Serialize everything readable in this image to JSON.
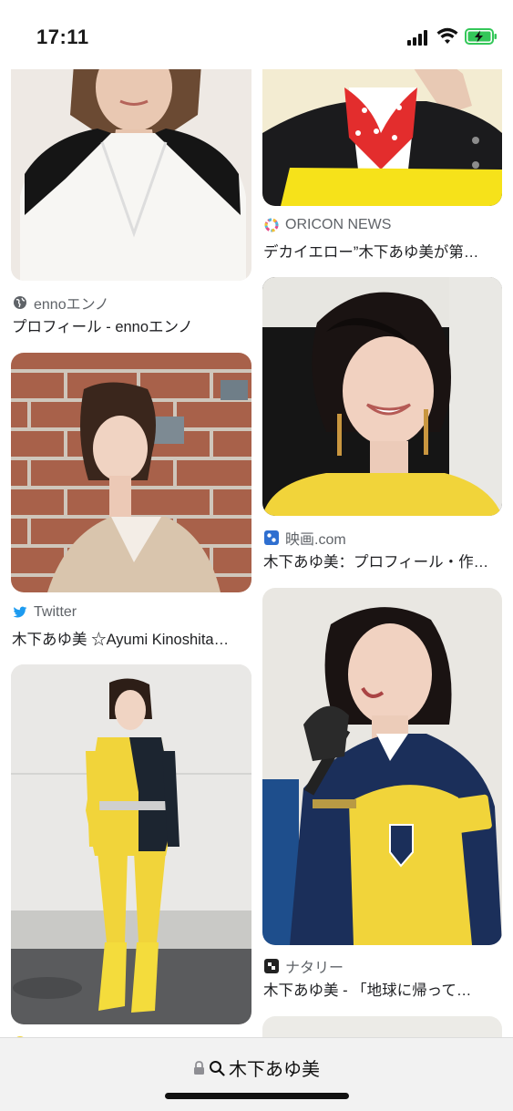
{
  "status": {
    "time": "17:11"
  },
  "results": [
    {
      "source": "ennoエンノ",
      "title": "プロフィール - ennoエンノ",
      "icon": "globe-icon"
    },
    {
      "source": "ORICON NEWS",
      "title": "デカイエロー”木下あゆ美が第…",
      "icon": "oricon-icon"
    },
    {
      "source": "Twitter",
      "title": "木下あゆ美 ☆Ayumi Kinoshita…",
      "icon": "twitter-icon"
    },
    {
      "source": "映画.com",
      "title": "木下あゆ美：プロフィール・作…",
      "icon": "eiga-icon"
    },
    {
      "source": "ナタリー",
      "title": "木下あゆ美 - 「地球に帰って…",
      "icon": "natalie-icon"
    }
  ],
  "address_bar": {
    "query": "木下あゆ美"
  },
  "colors": {
    "accent_yellow": "#f1d43a",
    "twitter_blue": "#1d9bf0"
  }
}
